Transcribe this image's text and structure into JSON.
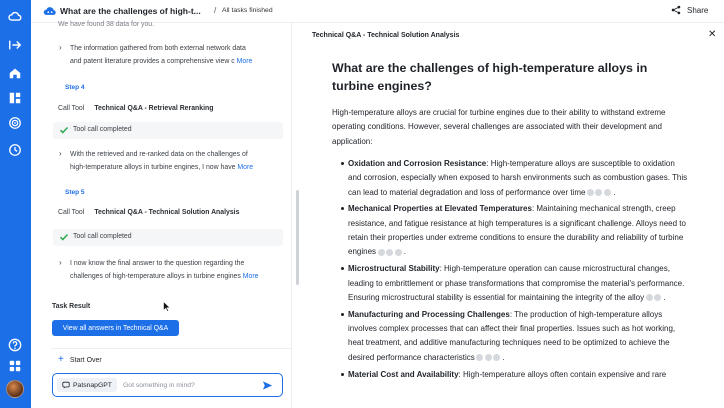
{
  "app": {
    "title": "What are the challenges of high-t...",
    "status": "All tasks finished",
    "share_label": "Share"
  },
  "left_panel": {
    "top_partial": "We have found 38 data for you.",
    "summary1": {
      "line1": "The information gathered from both external network data",
      "line2": "and patent literature provides a comprehensive view c",
      "more": "More"
    },
    "step4": {
      "label": "Step 4",
      "call_tool": "Call Tool",
      "tool_name": "Technical Q&A - Retrieval Reranking",
      "completed": "Tool call completed",
      "summary_line1": "With the retrieved and re-ranked data on the challenges of",
      "summary_line2": "high-temperature alloys in turbine engines, I now have",
      "more": "More"
    },
    "step5": {
      "label": "Step 5",
      "call_tool": "Call Tool",
      "tool_name": "Technical Q&A - Technical Solution Analysis",
      "completed": "Tool call completed",
      "summary_line1": "I now know the final answer to the question regarding the",
      "summary_line2": "challenges of high-temperature alloys in turbine engines",
      "more": "More"
    },
    "task_result": "Task Result",
    "view_all_button": "View all answers in Technical Q&A",
    "start_over": "Start Over",
    "input": {
      "model": "PatsnapGPT",
      "placeholder": "Got something in mind?"
    }
  },
  "right_panel": {
    "title": "Technical Q&A - Technical Solution Analysis",
    "question": "What are the challenges of high-temperature alloys in turbine engines?",
    "intro": "High-temperature alloys are crucial for turbine engines due to their ability to withstand extreme operating conditions. However, several challenges are associated with their development and application:",
    "bullets": [
      {
        "heading": "Oxidation and Corrosion Resistance",
        "text": ": High-temperature alloys are susceptible to oxidation and corrosion, especially when exposed to harsh environments such as combustion gases. This can lead to material degradation and loss of performance over time",
        "citations": 3
      },
      {
        "heading": "Mechanical Properties at Elevated Temperatures",
        "text": ": Maintaining mechanical strength, creep resistance, and fatigue resistance at high temperatures is a significant challenge. Alloys need to retain their properties under extreme conditions to ensure the durability and reliability of turbine engines",
        "citations": 3
      },
      {
        "heading": "Microstructural Stability",
        "text": ": High-temperature operation can cause microstructural changes, leading to embrittlement or phase transformations that compromise the material's performance. Ensuring microstructural stability is essential for maintaining the integrity of the alloy",
        "citations": 2
      },
      {
        "heading": "Manufacturing and Processing Challenges",
        "text": ": The production of high-temperature alloys involves complex processes that can affect their final properties. Issues such as hot working, heat treatment, and additive manufacturing techniques need to be optimized to achieve the desired performance characteristics",
        "citations": 3
      },
      {
        "heading": "Material Cost and Availability",
        "text": ": High-temperature alloys often contain expensive and rare",
        "citations": 0
      }
    ]
  },
  "colors": {
    "accent": "#1d6fe8",
    "success": "#2fa84f"
  },
  "icons": {
    "rail": [
      "logo-cloud-icon",
      "collapse-arrow-icon",
      "home-icon",
      "dashboard-icon",
      "radar-icon",
      "history-icon",
      "help-icon",
      "apps-grid-icon",
      "user-avatar"
    ]
  }
}
